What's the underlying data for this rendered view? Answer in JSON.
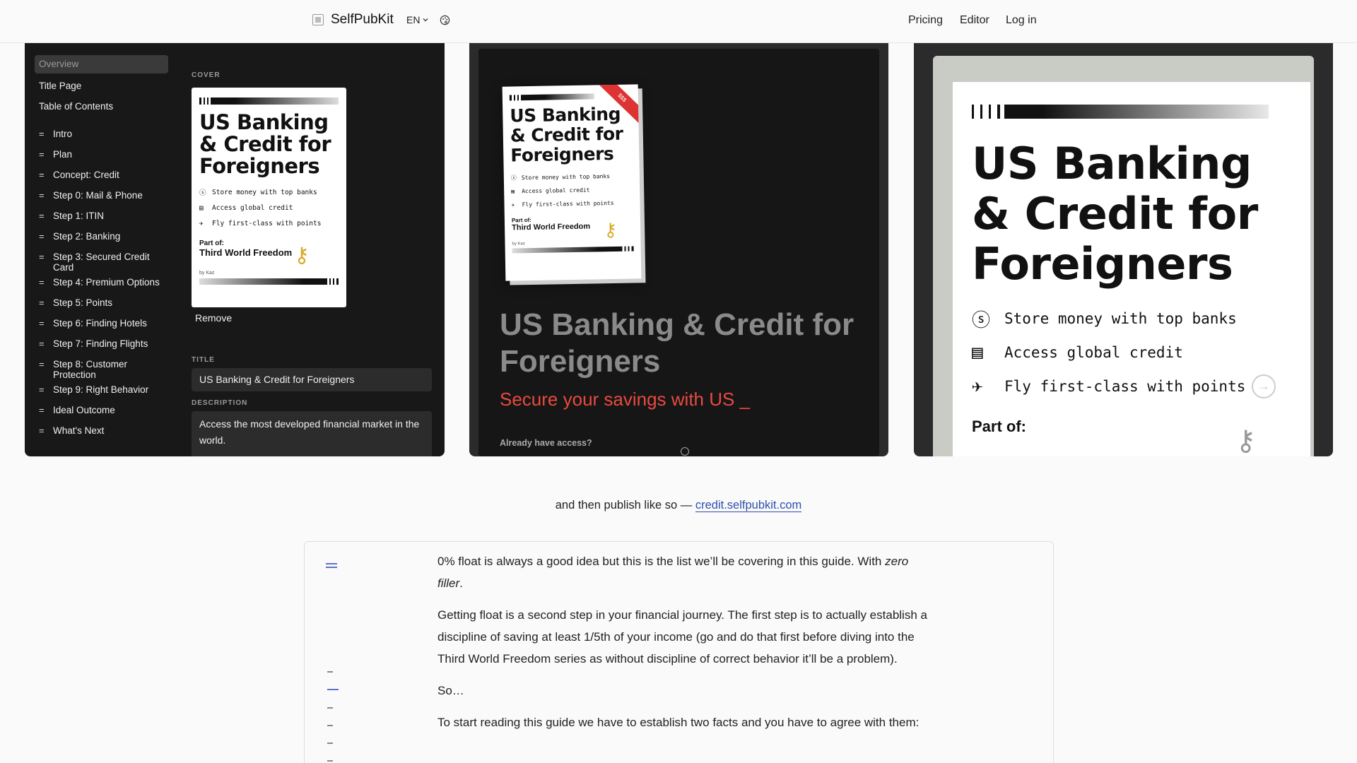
{
  "header": {
    "brand": "SelfPubKit",
    "lang": "EN",
    "nav": [
      "Pricing",
      "Editor",
      "Log in"
    ]
  },
  "editor": {
    "sidebar": {
      "top": [
        "Overview",
        "Title Page",
        "Table of Contents"
      ],
      "chapters": [
        "Intro",
        "Plan",
        "Concept: Credit",
        "Step 0: Mail & Phone",
        "Step 1: ITIN",
        "Step 2: Banking",
        "Step 3: Secured Credit Card",
        "Step 4: Premium Options",
        "Step 5: Points",
        "Step 6: Finding Hotels",
        "Step 7: Finding Flights",
        "Step 8: Customer Protection",
        "Step 9: Right Behavior",
        "Ideal Outcome",
        "What's Next"
      ]
    },
    "cover_label": "COVER",
    "remove_label": "Remove",
    "title_label": "TITLE",
    "title_value": "US Banking & Credit for Foreigners",
    "description_label": "DESCRIPTION",
    "description_value": "Access the most developed financial market in the world."
  },
  "book": {
    "title": "US Banking & Credit for Foreigners",
    "features": [
      "Store money with top banks",
      "Access global credit",
      "Fly first-class with points"
    ],
    "part_of_label": "Part of:",
    "series": "Third World Freedom",
    "author": "by Kaz",
    "ribbon": "$$$"
  },
  "landing": {
    "title": "US Banking & Credit for Foreigners",
    "tagline": "Secure your savings with US _",
    "access": "Already have access?"
  },
  "caption": {
    "text": "and then publish like so —",
    "link": "credit.selfpubkit.com"
  },
  "reader": {
    "p1_a": "0% float is always a good idea but this is the list we’ll be covering in this guide. With ",
    "p1_em": "zero filler",
    "p1_b": ".",
    "p2": "Getting float is a second step in your financial journey. The first step is to actually establish a discipline of saving at least 1/5th of your income (go and do that first before diving into the Third World Freedom series as without discipline of correct behavior it’ll be a problem).",
    "p3": "So…",
    "p4": "To start reading this guide we have to establish two facts and you have to agree with them:"
  },
  "colors": {
    "accent_red": "#e84a3f",
    "link_blue": "#2f4fb0",
    "panel_dark": "#181818"
  }
}
